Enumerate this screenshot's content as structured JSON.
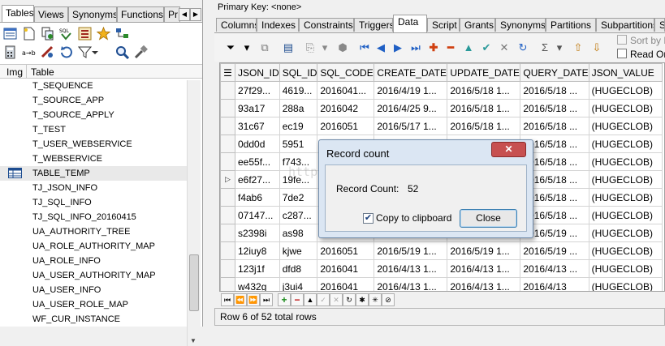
{
  "left_tabs": [
    "Tables",
    "Views",
    "Synonyms",
    "Functions",
    "Pr"
  ],
  "list_header": {
    "img": "Img",
    "table": "Table"
  },
  "tables": [
    "T_SEQUENCE",
    "T_SOURCE_APP",
    "T_SOURCE_APPLY",
    "T_TEST",
    "T_USER_WEBSERVICE",
    "T_WEBSERVICE",
    "TABLE_TEMP",
    "TJ_JSON_INFO",
    "TJ_SQL_INFO",
    "TJ_SQL_INFO_20160415",
    "UA_AUTHORITY_TREE",
    "UA_ROLE_AUTHORITY_MAP",
    "UA_ROLE_INFO",
    "UA_USER_AUTHORITY_MAP",
    "UA_USER_INFO",
    "UA_USER_ROLE_MAP",
    "WF_CUR_INSTANCE"
  ],
  "primary_key": "Primary Key:   <none>",
  "right_tabs": [
    "Columns",
    "Indexes",
    "Constraints",
    "Triggers",
    "Data",
    "Script",
    "Grants",
    "Synonyms",
    "Partitions",
    "Subpartitions",
    "S"
  ],
  "toolbar_options": {
    "sort_label": "Sort by P",
    "readonly_label": "Read Onl"
  },
  "grid": {
    "columns": [
      "JSON_ID",
      "SQL_ID",
      "SQL_CODE",
      "CREATE_DATE",
      "UPDATE_DATE",
      "QUERY_DATE",
      "JSON_VALUE"
    ],
    "rows": [
      [
        "27f29...",
        "4619...",
        "2016041...",
        "2016/4/19 1...",
        "2016/5/18 1...",
        "2016/5/18 ...",
        "(HUGECLOB)"
      ],
      [
        "93a17",
        "288a",
        "2016042",
        "2016/4/25 9...",
        "2016/5/18 1...",
        "2016/5/18 ...",
        "(HUGECLOB)"
      ],
      [
        "31c67",
        "ec19",
        "2016051",
        "2016/5/17 1...",
        "2016/5/18 1...",
        "2016/5/18 ...",
        "(HUGECLOB)"
      ],
      [
        "0dd0d",
        "5951",
        "2016051",
        "2016/5/17",
        "2016/5/18 1...",
        "2016/5/18 ...",
        "(HUGECLOB)"
      ],
      [
        "ee55f...",
        "f743...",
        "",
        "",
        "",
        "2016/5/18 ...",
        "(HUGECLOB)"
      ],
      [
        "e6f27...",
        "19fe...",
        "",
        "",
        "",
        "2016/5/18 ...",
        "(HUGECLOB)"
      ],
      [
        "f4ab6",
        "7de2",
        "",
        "",
        "",
        "2016/5/18 ...",
        "(HUGECLOB)"
      ],
      [
        "07147...",
        "c287...",
        "",
        "",
        "",
        "2016/5/18 ...",
        "(HUGECLOB)"
      ],
      [
        "s2398i",
        "as98",
        "",
        "",
        "",
        "2016/5/19 ...",
        "(HUGECLOB)"
      ],
      [
        "12iuy8",
        "kjwe",
        "2016051",
        "2016/5/19 1...",
        "2016/5/19 1...",
        "2016/5/19 ...",
        "(HUGECLOB)"
      ],
      [
        "123j1f",
        "dfd8",
        "2016041",
        "2016/4/13 1...",
        "2016/4/13 1...",
        "2016/4/13 ...",
        "(HUGECLOB)"
      ],
      [
        "w432g",
        "j3ui4",
        "2016041",
        "2016/4/13 1...",
        "2016/4/13 1...",
        "2016/4/13",
        "(HUGECLOB)"
      ]
    ]
  },
  "status": "Row 6 of 52 total rows",
  "dialog": {
    "title": "Record count",
    "close_glyph": "✕",
    "label": "Record Count:",
    "value": "52",
    "checkbox_label": "Copy to clipboard",
    "ok_label": "Close"
  },
  "watermark": "http://blog.csdn.net/"
}
